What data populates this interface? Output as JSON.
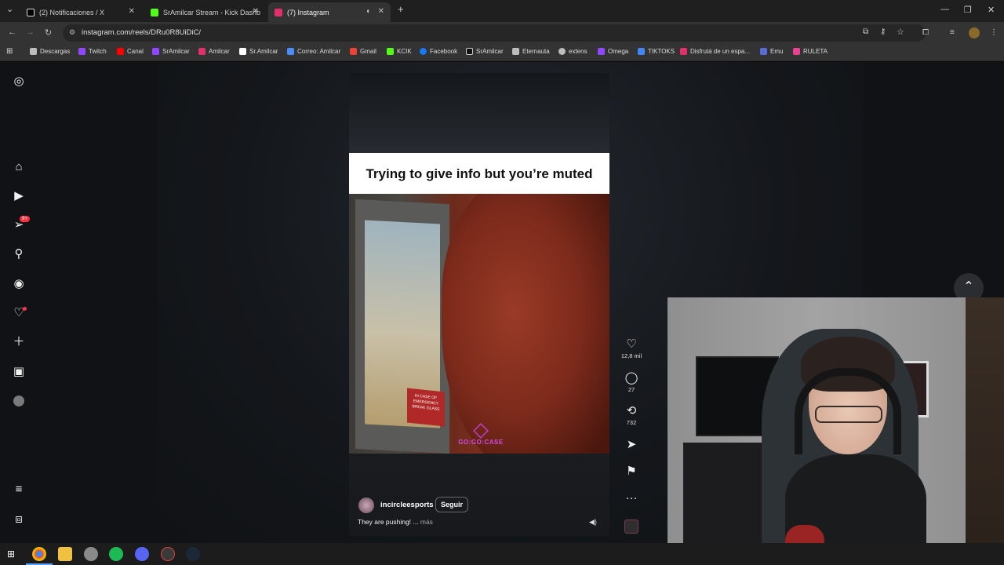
{
  "browser": {
    "tabs": [
      {
        "title": "(2) Notificaciones / X",
        "favicon_color": "#ffffff",
        "icon": "x-logo-icon"
      },
      {
        "title": "SrAmilcar Stream - Kick Dashb",
        "favicon_color": "#53fc18",
        "icon": "kick-logo-icon"
      },
      {
        "title": "(7) Instagram",
        "favicon_color": "#e1306c",
        "icon": "instagram-logo-icon"
      }
    ],
    "new_tab": "+",
    "url": "instagram.com/reels/DRu0R8UiDiC/",
    "bookmarks": [
      {
        "label": "Descargas",
        "color": "#bdbdbd"
      },
      {
        "label": "Twitch",
        "color": "#9146ff"
      },
      {
        "label": "Canal",
        "color": "#ff0000"
      },
      {
        "label": "SrAmilcar",
        "color": "#9146ff"
      },
      {
        "label": "Amilcar",
        "color": "#e1306c"
      },
      {
        "label": "Sr.Amilcar",
        "color": "#ffffff"
      },
      {
        "label": "Correo: Amilcar",
        "color": "#4a8df7"
      },
      {
        "label": "Gmail",
        "color": "#ea4335"
      },
      {
        "label": "KCIK",
        "color": "#53fc18"
      },
      {
        "label": "Facebook",
        "color": "#1877f2"
      },
      {
        "label": "SrAmilcar",
        "color": "#ffffff"
      },
      {
        "label": "Eternauta",
        "color": "#bdbdbd"
      },
      {
        "label": "extens",
        "color": "#bdbdbd"
      },
      {
        "label": "Omega",
        "color": "#9146ff"
      },
      {
        "label": "TIKTOKS",
        "color": "#4285f4"
      },
      {
        "label": "Disfrutá de un espa...",
        "color": "#e1306c"
      },
      {
        "label": "Emu",
        "color": "#5a6bd6"
      },
      {
        "label": "RULETA",
        "color": "#e84393"
      }
    ]
  },
  "sidebar": {
    "items": [
      "instagram-logo-icon",
      "home-icon",
      "reels-icon",
      "messages-icon",
      "search-icon",
      "explore-icon",
      "notifications-icon",
      "create-icon",
      "dashboard-icon",
      "profile-avatar"
    ],
    "badge": "9+",
    "menu": "more-menu-icon",
    "meta": "also-from-meta-icon"
  },
  "reel": {
    "caption_overlay": "Trying to give info but you’re muted",
    "sign_text": "IN CASE OF EMERGENCY BREAK GLASS",
    "watermark": "GO:GO:CASE",
    "username": "incircleesports",
    "follow_label": "Seguir",
    "description": "They are pushing! ...",
    "more_label": "más",
    "likes": "12,8 mil",
    "comments": "27",
    "reposts": "732"
  },
  "colors": {
    "accent": "#ff3040",
    "background": "#101215"
  }
}
